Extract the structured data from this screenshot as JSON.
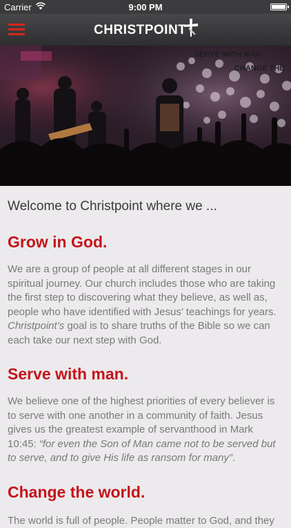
{
  "status_bar": {
    "carrier": "Carrier",
    "time": "9:00 PM"
  },
  "navbar": {
    "logo_text": "CHRISTPOINT"
  },
  "hero": {
    "overlay_line1": "SERVE WITH MAN",
    "overlay_line2": "CHANGE THE"
  },
  "content": {
    "welcome": "Welcome to Christpoint where we ...",
    "sections": [
      {
        "title": "Grow in God.",
        "body_part1": "We are a group of people at all different stages in our spiritual journey. Our church includes those who are taking the first step to discovering what they believe, as well as, people who have identified with Jesus’ teachings for years. ",
        "body_italic": "Christpoint’s",
        "body_part2": " goal is to share truths of the Bible so we can each take our next step with God."
      },
      {
        "title": "Serve with man.",
        "body_part1": "We believe one of the highest priorities of every believer is to serve with one another in a community of faith. Jesus gives us the greatest example of servanthood in Mark 10:45: ",
        "body_italic": "“for even the Son of Man came not to be served but to serve, and to give His life as ransom for many”",
        "body_part2": "."
      },
      {
        "title": "Change the world.",
        "body_part1": "The world is full of people. People matter to God, and they"
      }
    ]
  }
}
